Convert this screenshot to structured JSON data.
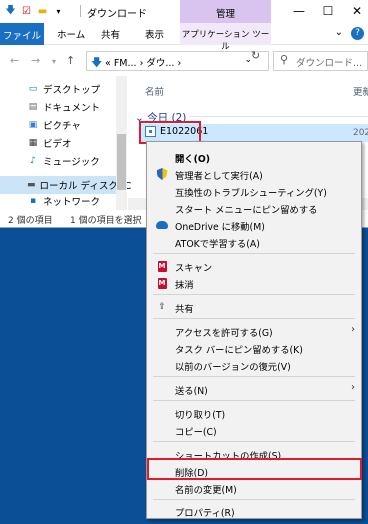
{
  "window": {
    "title": "ダウンロード",
    "manage_tab": "管理",
    "ribbon_tabs": [
      "ファイル",
      "ホーム",
      "共有",
      "表示"
    ],
    "app_tools_tab": "アプリケーション ツール",
    "minimize_glyph": "—",
    "maximize_glyph": "☐",
    "close_glyph": "✕"
  },
  "address": {
    "path": "« FM... › ダウ... ›",
    "search_placeholder": "ダウンロード..."
  },
  "sidebar": {
    "items": [
      {
        "label": "デスクトップ",
        "icon": "desktop-icon"
      },
      {
        "label": "ドキュメント",
        "icon": "document-icon"
      },
      {
        "label": "ピクチャ",
        "icon": "pictures-icon"
      },
      {
        "label": "ビデオ",
        "icon": "video-icon"
      },
      {
        "label": "ミュージック",
        "icon": "music-icon"
      },
      {
        "label": "ローカル ディスク (C",
        "icon": "drive-icon"
      },
      {
        "label": "ネットワーク",
        "icon": "network-icon"
      }
    ]
  },
  "filepane": {
    "col_name": "名前",
    "col_updated": "更新",
    "group_header": "今日 (2)",
    "file_name": "E1022061",
    "file_date": "202"
  },
  "status": {
    "item_count": "2 個の項目",
    "selected": "1 個の項目を選択"
  },
  "context_menu": {
    "open": "開く(O)",
    "run_as_admin": "管理者として実行(A)",
    "troubleshoot": "互換性のトラブルシューティング(Y)",
    "pin_start": "スタート メニューにピン留めする",
    "onedrive": "OneDrive に移動(M)",
    "atok": "ATOKで学習する(A)",
    "scan": "スキャン",
    "erase": "抹消",
    "share": "共有",
    "give_access": "アクセスを許可する(G)",
    "pin_taskbar": "タスク バーにピン留めする(K)",
    "restore_prev": "以前のバージョンの復元(V)",
    "send_to": "送る(N)",
    "cut": "切り取り(T)",
    "copy": "コピー(C)",
    "create_shortcut": "ショートカットの作成(S)",
    "delete": "削除(D)",
    "rename": "名前の変更(M)",
    "properties": "プロパティ(R)"
  },
  "colors": {
    "highlight_red": "#e01c2c",
    "selection_blue": "#cce8ff",
    "file_tab_blue": "#1a6fc3",
    "manage_purple": "#d9c3ef",
    "desktop_blue": "#0b4f96"
  }
}
